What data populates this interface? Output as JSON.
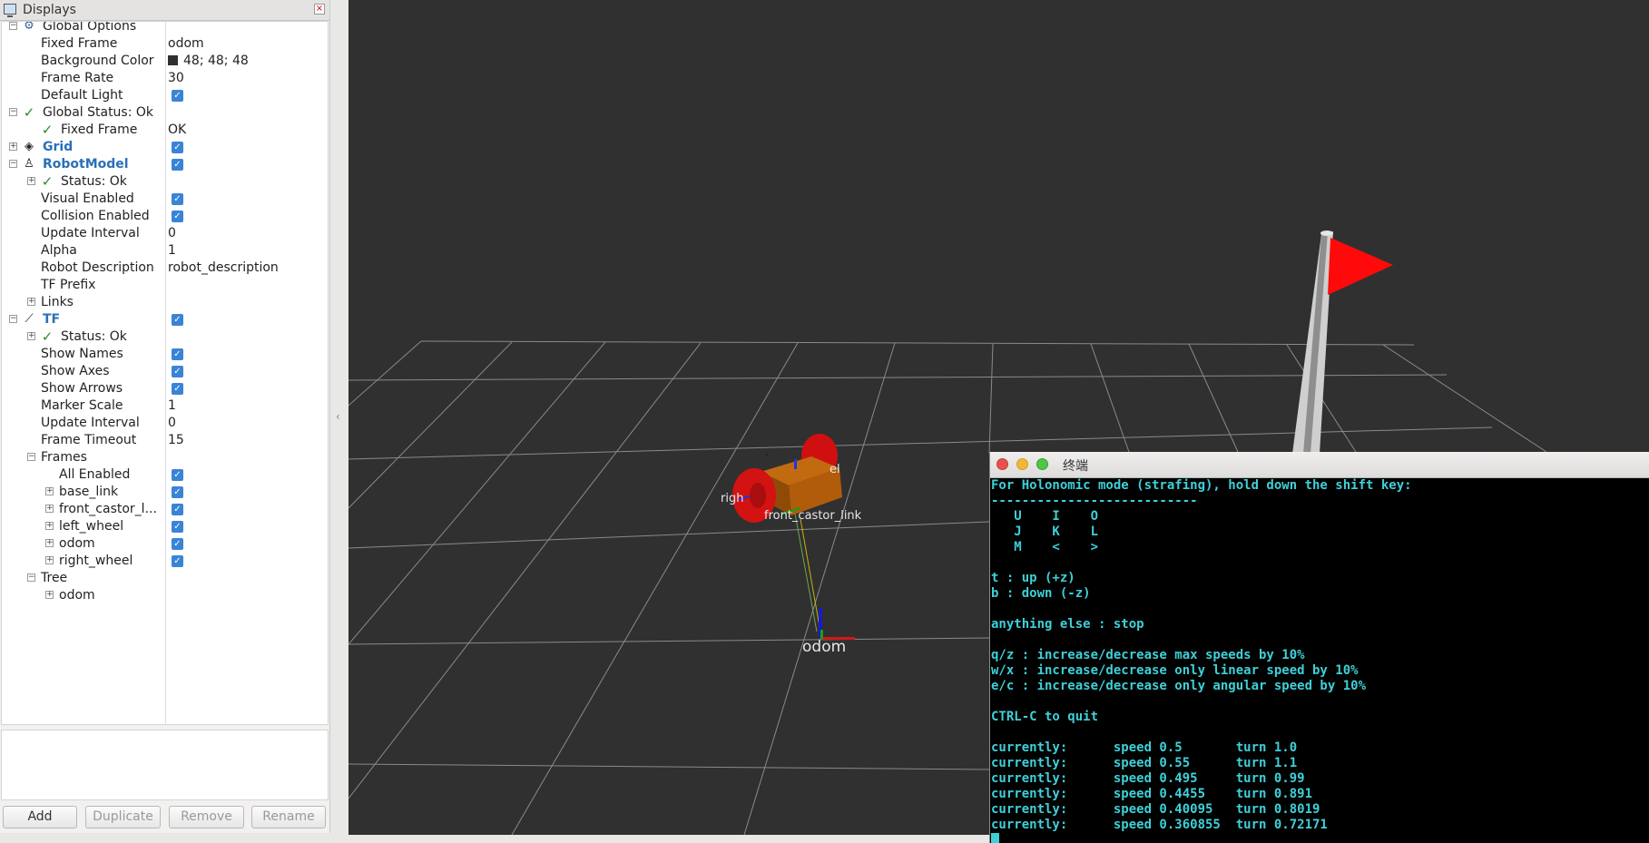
{
  "panel": {
    "title": "Displays",
    "close_glyph": "×",
    "buttons": {
      "add": "Add",
      "duplicate": "Duplicate",
      "remove": "Remove",
      "rename": "Rename"
    }
  },
  "tree": [
    {
      "id": "global-options",
      "label": "Global Options",
      "value": "",
      "indent": 0,
      "expander": "−",
      "icon": "gear-icon",
      "style": "normal"
    },
    {
      "id": "fixed-frame",
      "label": "Fixed Frame",
      "value": "odom",
      "indent": 1,
      "expander": "",
      "icon": "",
      "style": "normal"
    },
    {
      "id": "background-color",
      "label": "Background Color",
      "value": "48; 48; 48",
      "swatch": "#303030",
      "indent": 1,
      "expander": "",
      "icon": "",
      "style": "normal"
    },
    {
      "id": "frame-rate",
      "label": "Frame Rate",
      "value": "30",
      "indent": 1,
      "expander": "",
      "icon": "",
      "style": "normal"
    },
    {
      "id": "default-light",
      "label": "Default Light",
      "checkbox": true,
      "indent": 1,
      "expander": "",
      "icon": "",
      "style": "normal"
    },
    {
      "id": "global-status",
      "label": "Global Status: Ok",
      "value": "",
      "indent": 0,
      "expander": "−",
      "icon": "check-icon",
      "style": "normal"
    },
    {
      "id": "status-fixed-frame",
      "label": "Fixed Frame",
      "value": "OK",
      "indent": 1,
      "expander": "",
      "icon": "check-icon",
      "style": "normal"
    },
    {
      "id": "grid",
      "label": "Grid",
      "checkbox": true,
      "indent": 0,
      "expander": "+",
      "icon": "grid-icon",
      "style": "blue"
    },
    {
      "id": "robotmodel",
      "label": "RobotModel",
      "checkbox": true,
      "indent": 0,
      "expander": "−",
      "icon": "robot-icon",
      "style": "blue"
    },
    {
      "id": "robotmodel-status",
      "label": "Status: Ok",
      "value": "",
      "indent": 1,
      "expander": "+",
      "icon": "check-icon",
      "style": "normal"
    },
    {
      "id": "visual-enabled",
      "label": "Visual Enabled",
      "checkbox": true,
      "indent": 1,
      "expander": "",
      "icon": "",
      "style": "normal"
    },
    {
      "id": "collision-enabled",
      "label": "Collision Enabled",
      "checkbox": true,
      "indent": 1,
      "expander": "",
      "icon": "",
      "style": "normal"
    },
    {
      "id": "update-interval-rm",
      "label": "Update Interval",
      "value": "0",
      "indent": 1,
      "expander": "",
      "icon": "",
      "style": "normal"
    },
    {
      "id": "alpha",
      "label": "Alpha",
      "value": "1",
      "indent": 1,
      "expander": "",
      "icon": "",
      "style": "normal"
    },
    {
      "id": "robot-description",
      "label": "Robot Description",
      "value": "robot_description",
      "indent": 1,
      "expander": "",
      "icon": "",
      "style": "normal"
    },
    {
      "id": "tf-prefix",
      "label": "TF Prefix",
      "value": "",
      "indent": 1,
      "expander": "",
      "icon": "",
      "style": "normal"
    },
    {
      "id": "links",
      "label": "Links",
      "value": "",
      "indent": 1,
      "expander": "+",
      "icon": "",
      "style": "normal"
    },
    {
      "id": "tf",
      "label": "TF",
      "checkbox": true,
      "indent": 0,
      "expander": "−",
      "icon": "tf-icon",
      "style": "blue"
    },
    {
      "id": "tf-status",
      "label": "Status: Ok",
      "value": "",
      "indent": 1,
      "expander": "+",
      "icon": "check-icon",
      "style": "normal"
    },
    {
      "id": "show-names",
      "label": "Show Names",
      "checkbox": true,
      "indent": 1,
      "expander": "",
      "icon": "",
      "style": "normal"
    },
    {
      "id": "show-axes",
      "label": "Show Axes",
      "checkbox": true,
      "indent": 1,
      "expander": "",
      "icon": "",
      "style": "normal"
    },
    {
      "id": "show-arrows",
      "label": "Show Arrows",
      "checkbox": true,
      "indent": 1,
      "expander": "",
      "icon": "",
      "style": "normal"
    },
    {
      "id": "marker-scale",
      "label": "Marker Scale",
      "value": "1",
      "indent": 1,
      "expander": "",
      "icon": "",
      "style": "normal"
    },
    {
      "id": "update-interval-tf",
      "label": "Update Interval",
      "value": "0",
      "indent": 1,
      "expander": "",
      "icon": "",
      "style": "normal"
    },
    {
      "id": "frame-timeout",
      "label": "Frame Timeout",
      "value": "15",
      "indent": 1,
      "expander": "",
      "icon": "",
      "style": "normal"
    },
    {
      "id": "frames",
      "label": "Frames",
      "value": "",
      "indent": 1,
      "expander": "−",
      "icon": "",
      "style": "normal"
    },
    {
      "id": "all-enabled",
      "label": "All Enabled",
      "checkbox": true,
      "indent": 2,
      "expander": "",
      "icon": "",
      "style": "normal"
    },
    {
      "id": "frame-base-link",
      "label": "base_link",
      "checkbox": true,
      "indent": 2,
      "expander": "+",
      "icon": "",
      "style": "normal"
    },
    {
      "id": "frame-front-castor",
      "label": "front_castor_l...",
      "checkbox": true,
      "indent": 2,
      "expander": "+",
      "icon": "",
      "style": "normal"
    },
    {
      "id": "frame-left-wheel",
      "label": "left_wheel",
      "checkbox": true,
      "indent": 2,
      "expander": "+",
      "icon": "",
      "style": "normal"
    },
    {
      "id": "frame-odom",
      "label": "odom",
      "checkbox": true,
      "indent": 2,
      "expander": "+",
      "icon": "",
      "style": "normal"
    },
    {
      "id": "frame-right-wheel",
      "label": "right_wheel",
      "checkbox": true,
      "indent": 2,
      "expander": "+",
      "icon": "",
      "style": "normal"
    },
    {
      "id": "tree-node",
      "label": "Tree",
      "value": "",
      "indent": 1,
      "expander": "−",
      "icon": "",
      "style": "normal"
    },
    {
      "id": "tree-odom",
      "label": "odom",
      "value": "",
      "indent": 2,
      "expander": "+",
      "icon": "",
      "style": "normal"
    }
  ],
  "scene": {
    "background": "#303030",
    "labels": {
      "odom": "odom",
      "front_castor": "front_castor_link",
      "right": "righ",
      "left": "el"
    }
  },
  "terminal": {
    "title": "终端",
    "lines": [
      "For Holonomic mode (strafing), hold down the shift key:",
      "---------------------------",
      "   U    I    O",
      "   J    K    L",
      "   M    <    >",
      "",
      "t : up (+z)",
      "b : down (-z)",
      "",
      "anything else : stop",
      "",
      "q/z : increase/decrease max speeds by 10%",
      "w/x : increase/decrease only linear speed by 10%",
      "e/c : increase/decrease only angular speed by 10%",
      "",
      "CTRL-C to quit",
      "",
      "currently:      speed 0.5       turn 1.0",
      "currently:      speed 0.55      turn 1.1",
      "currently:      speed 0.495     turn 0.99",
      "currently:      speed 0.4455    turn 0.891",
      "currently:      speed 0.40095   turn 0.8019",
      "currently:      speed 0.360855  turn 0.72171"
    ]
  }
}
